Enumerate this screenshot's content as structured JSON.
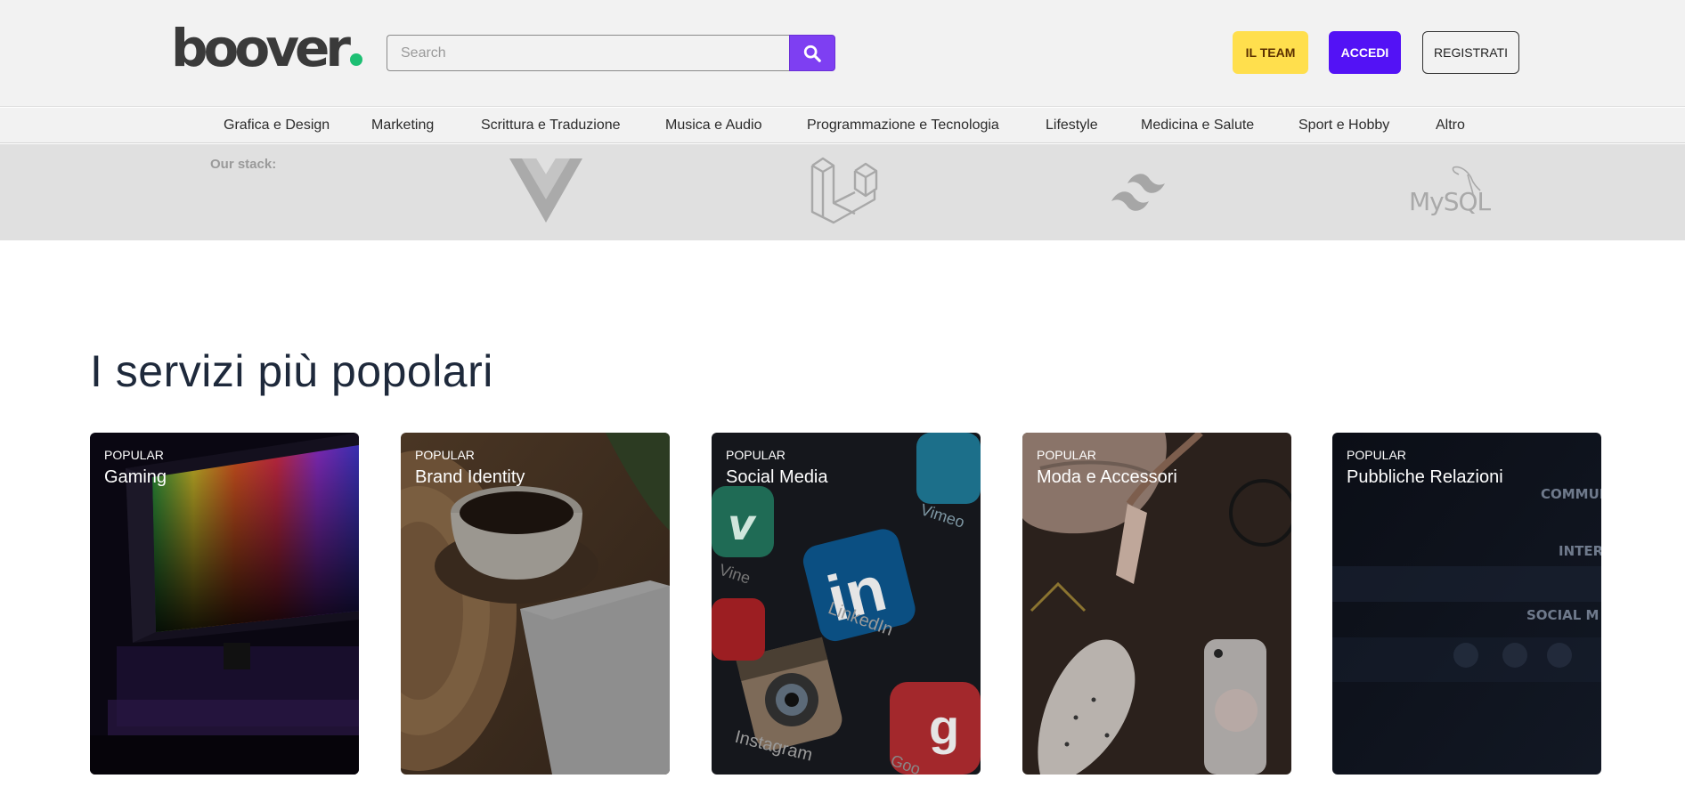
{
  "header": {
    "logo": "boover",
    "search": {
      "placeholder": "Search",
      "value": ""
    },
    "buttons": {
      "team": "IL TEAM",
      "login": "ACCEDI",
      "register": "REGISTRATI"
    },
    "colors": {
      "logo_dot": "#1dbf73",
      "search_button": "#7e3ff2",
      "team": "#ffdf4d",
      "login": "#5312f5"
    }
  },
  "categories": [
    "Grafica e Design",
    "Marketing",
    "Scrittura e Traduzione",
    "Musica e Audio",
    "Programmazione e Tecnologia",
    "Lifestyle",
    "Medicina e Salute",
    "Sport e Hobby",
    "Altro"
  ],
  "stack": {
    "label": "Our stack:",
    "logos": [
      "vue-logo-icon",
      "laravel-logo-icon",
      "tailwind-logo-icon",
      "mysql-logo-icon"
    ],
    "mysql_text": "MySQL"
  },
  "main": {
    "title": "I servizi più popolari",
    "cards": [
      {
        "eyebrow": "POPULAR",
        "title": "Gaming"
      },
      {
        "eyebrow": "POPULAR",
        "title": "Brand Identity"
      },
      {
        "eyebrow": "POPULAR",
        "title": "Social Media"
      },
      {
        "eyebrow": "POPULAR",
        "title": "Moda e Accessori"
      },
      {
        "eyebrow": "POPULAR",
        "title": "Pubbliche Relazioni",
        "image_text": [
          "COMMUN",
          "INTER",
          "SOCIAL M"
        ]
      }
    ],
    "social_media_image_text": [
      "LinkedIn",
      "Instagram",
      "Vimeo",
      "Vine",
      "Goo"
    ]
  }
}
